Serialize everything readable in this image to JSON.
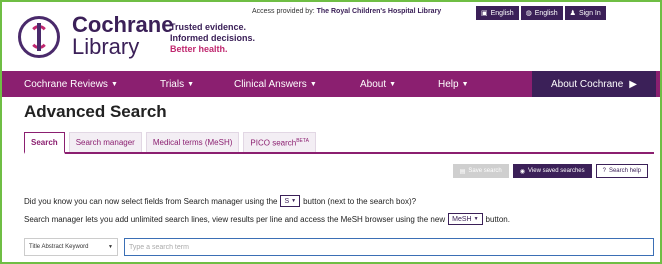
{
  "header": {
    "brand_line1": "Cochrane",
    "brand_line2": "Library",
    "tagline1": "Trusted evidence.",
    "tagline2": "Informed decisions.",
    "tagline3": "Better health.",
    "access_label": "Access provided by:",
    "access_org": "The Royal Children's Hospital Library",
    "util": [
      {
        "label": "English",
        "icon": "document-icon"
      },
      {
        "label": "English",
        "icon": "globe-icon"
      },
      {
        "label": "Sign In",
        "icon": "user-icon"
      }
    ]
  },
  "nav": {
    "items": [
      "Cochrane Reviews",
      "Trials",
      "Clinical Answers",
      "About",
      "Help"
    ],
    "about_cochrane": "About Cochrane"
  },
  "page": {
    "title": "Advanced Search"
  },
  "tabs": [
    "Search",
    "Search manager",
    "Medical terms (MeSH)",
    "PICO search",
    "BETA"
  ],
  "buttons": {
    "save": "Save search",
    "view_saved": "View saved searches",
    "help": "Search help"
  },
  "info": {
    "line1_a": "Did you know you can now select fields from Search manager using the",
    "line1_btn": "S",
    "line1_b": "button (next to the search box)?",
    "line2_a": "Search manager lets you add unlimited search lines, view results per line and access the MeSH browser using the new",
    "line2_btn": "MeSH",
    "line2_b": "button."
  },
  "search": {
    "field_value": "Title Abstract Keyword",
    "placeholder": "Type a search term"
  },
  "colors": {
    "purple": "#8b1f70",
    "dark_purple": "#3b2058",
    "border_green": "#6fbe44"
  }
}
